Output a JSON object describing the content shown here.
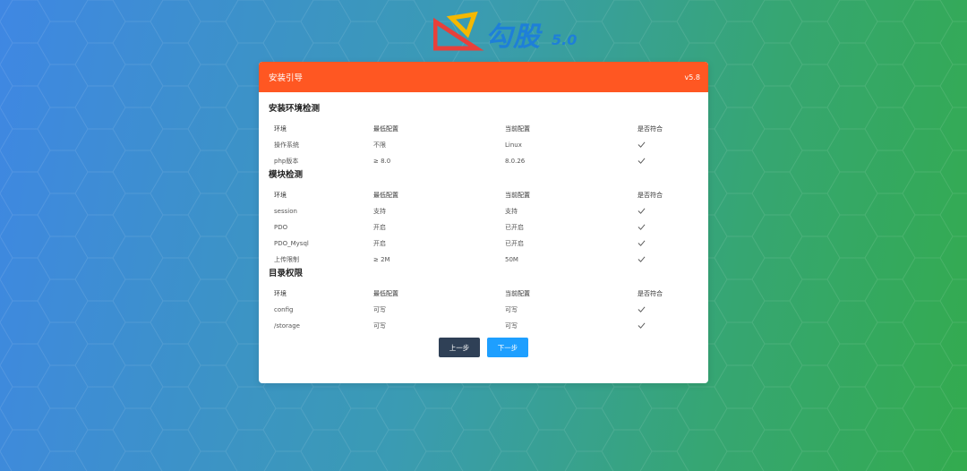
{
  "logo": {
    "text": "勾股",
    "version": "5.0"
  },
  "header": {
    "title": "安装引导",
    "version": "v5.8"
  },
  "columns": [
    "环境",
    "最低配置",
    "当前配置",
    "是否符合"
  ],
  "sections": [
    {
      "title": "安装环境检测",
      "rows": [
        {
          "env": "操作系统",
          "min": "不限",
          "current": "Linux"
        },
        {
          "env": "php版本",
          "min": "≥ 8.0",
          "current": "8.0.26"
        }
      ]
    },
    {
      "title": "模块检测",
      "rows": [
        {
          "env": "session",
          "min": "支持",
          "current": "支持"
        },
        {
          "env": "PDO",
          "min": "开启",
          "current": "已开启"
        },
        {
          "env": "PDO_Mysql",
          "min": "开启",
          "current": "已开启"
        },
        {
          "env": "上传限制",
          "min": "≥ 2M",
          "current": "50M"
        }
      ]
    },
    {
      "title": "目录权限",
      "rows": [
        {
          "env": "config",
          "min": "可写",
          "current": "可写"
        },
        {
          "env": "/storage",
          "min": "可写",
          "current": "可写"
        }
      ]
    }
  ],
  "buttons": {
    "prev": "上一步",
    "next": "下一步"
  },
  "colors": {
    "header": "#ff5722",
    "prev": "#2f4056",
    "next": "#1e9fff"
  }
}
